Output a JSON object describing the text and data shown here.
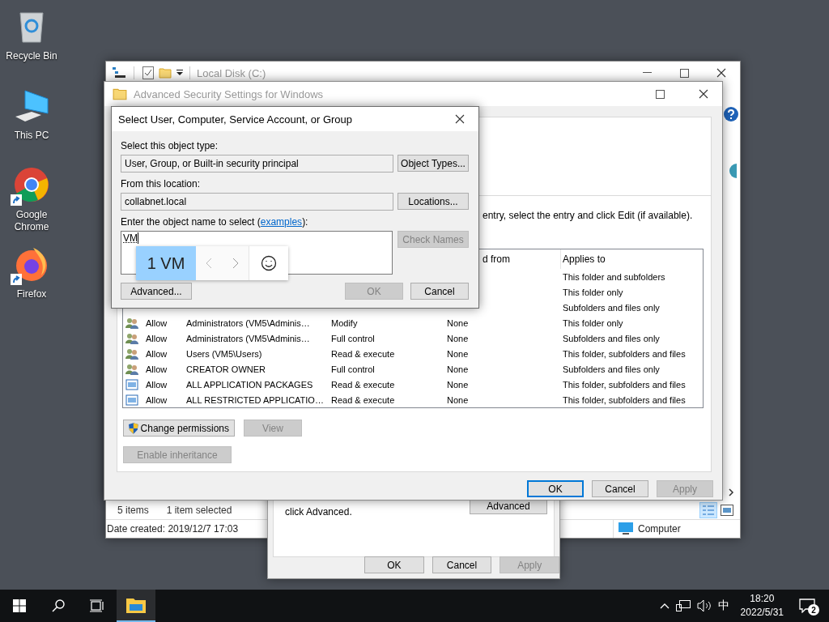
{
  "desktop_icons": [
    {
      "label": "Recycle Bin",
      "kind": "recycle",
      "shortcut": false
    },
    {
      "label": "This PC",
      "kind": "pc",
      "shortcut": false
    },
    {
      "label": "Google Chrome",
      "kind": "chrome",
      "shortcut": true
    },
    {
      "label": "Firefox",
      "kind": "firefox",
      "shortcut": true
    }
  ],
  "explorer": {
    "title": "Local Disk (C:)",
    "item_count": "5 items",
    "selection": "1 item selected",
    "details": "Date created: 2019/12/7 17:03",
    "location": "Computer"
  },
  "advanced_security": {
    "title": "Advanced Security Settings for Windows",
    "instruction": "entry, select the entry and click Edit (if available).",
    "columns": [
      "d from",
      "Applies to"
    ],
    "rows": [
      {
        "applies_to": "This folder and subfolders"
      },
      {
        "applies_to": "This folder only"
      },
      {
        "applies_to": "Subfolders and files only"
      },
      {
        "kind": "users",
        "type": "Allow",
        "principal": "Administrators (VM5\\Adminis…",
        "access": "Modify",
        "inherited_from": "None",
        "applies_to": "This folder only"
      },
      {
        "kind": "users",
        "type": "Allow",
        "principal": "Administrators (VM5\\Adminis…",
        "access": "Full control",
        "inherited_from": "None",
        "applies_to": "Subfolders and files only"
      },
      {
        "kind": "users",
        "type": "Allow",
        "principal": "Users (VM5\\Users)",
        "access": "Read & execute",
        "inherited_from": "None",
        "applies_to": "This folder, subfolders and files"
      },
      {
        "kind": "users",
        "type": "Allow",
        "principal": "CREATOR OWNER",
        "access": "Full control",
        "inherited_from": "None",
        "applies_to": "Subfolders and files only"
      },
      {
        "kind": "package",
        "type": "Allow",
        "principal": "ALL APPLICATION PACKAGES",
        "access": "Read & execute",
        "inherited_from": "None",
        "applies_to": "This folder, subfolders and files"
      },
      {
        "kind": "package",
        "type": "Allow",
        "principal": "ALL RESTRICTED APPLICATIO…",
        "access": "Read & execute",
        "inherited_from": "None",
        "applies_to": "This folder, subfolders and files"
      }
    ],
    "actions": [
      {
        "label": "Change permissions",
        "kind": "elevated",
        "disabled": false
      },
      {
        "label": "View",
        "kind": "plain",
        "disabled": true
      },
      {
        "label": "Enable inheritance",
        "kind": "plain",
        "disabled": true
      }
    ],
    "footer_buttons": [
      {
        "label": "OK",
        "disabled": false,
        "default": true
      },
      {
        "label": "Cancel",
        "disabled": false,
        "default": false
      },
      {
        "label": "Apply",
        "disabled": true,
        "default": false
      }
    ]
  },
  "select_dialog": {
    "title": "Select User, Computer, Service Account, or Group",
    "object_type_label": "Select this object type:",
    "object_type": "User, Group, or Built-in security principal",
    "object_types_button": "Object Types...",
    "location_label": "From this location:",
    "location": "collabnet.local",
    "locations_button": "Locations...",
    "name_label_start": "Enter the object name to select (",
    "name_label_link": "examples",
    "name_label_end": "):",
    "name_value": "VM",
    "check_names_button": {
      "label": "Check Names",
      "disabled": true
    },
    "advanced_button": "Advanced...",
    "ok_button": {
      "label": "OK",
      "disabled": true
    },
    "cancel_button": {
      "label": "Cancel",
      "disabled": false
    },
    "ime_candidates": [
      {
        "label": "1 VM",
        "selected": true
      }
    ]
  },
  "properties": {
    "text": "click Advanced.",
    "advanced_button": "Advanced",
    "buttons": [
      {
        "label": "OK",
        "disabled": false
      },
      {
        "label": "Cancel",
        "disabled": false
      },
      {
        "label": "Apply",
        "disabled": true
      }
    ]
  },
  "taskbar": {
    "apps": [
      {
        "kind": "explorer",
        "active": true
      }
    ],
    "input_indicator": "中",
    "time": "18:20",
    "date": "2022/5/31",
    "notification_count": "2"
  }
}
